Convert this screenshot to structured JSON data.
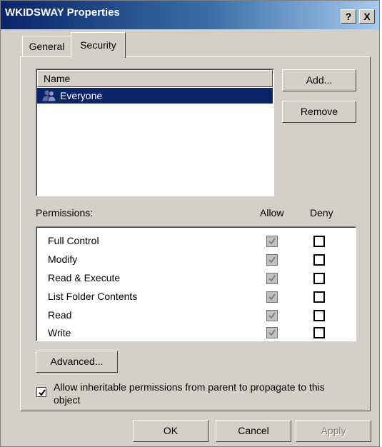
{
  "window": {
    "title": "WKIDSWAY Properties",
    "help_button": "?",
    "close_button": "X"
  },
  "tabs": [
    {
      "label": "General",
      "active": false
    },
    {
      "label": "Security",
      "active": true
    }
  ],
  "names": {
    "column_header": "Name",
    "items": [
      {
        "label": "Everyone",
        "icon": "group-icon",
        "selected": true
      }
    ]
  },
  "buttons": {
    "add": "Add...",
    "remove": "Remove",
    "advanced": "Advanced...",
    "ok": "OK",
    "cancel": "Cancel",
    "apply": "Apply"
  },
  "permissions": {
    "label": "Permissions:",
    "allow_header": "Allow",
    "deny_header": "Deny",
    "rows": [
      {
        "name": "Full Control",
        "allow": true,
        "allow_greyed": true,
        "deny": false
      },
      {
        "name": "Modify",
        "allow": true,
        "allow_greyed": true,
        "deny": false
      },
      {
        "name": "Read & Execute",
        "allow": true,
        "allow_greyed": true,
        "deny": false
      },
      {
        "name": "List Folder Contents",
        "allow": true,
        "allow_greyed": true,
        "deny": false
      },
      {
        "name": "Read",
        "allow": true,
        "allow_greyed": true,
        "deny": false
      },
      {
        "name": "Write",
        "allow": true,
        "allow_greyed": true,
        "deny": false
      }
    ]
  },
  "inherit": {
    "checked": true,
    "line1": "Allow inheritable permissions from parent to propagate to this",
    "line2": "object"
  },
  "colors": {
    "title_start": "#0a246a",
    "title_end": "#a6caf0",
    "face": "#d4d0c8",
    "selection": "#0a246a"
  }
}
